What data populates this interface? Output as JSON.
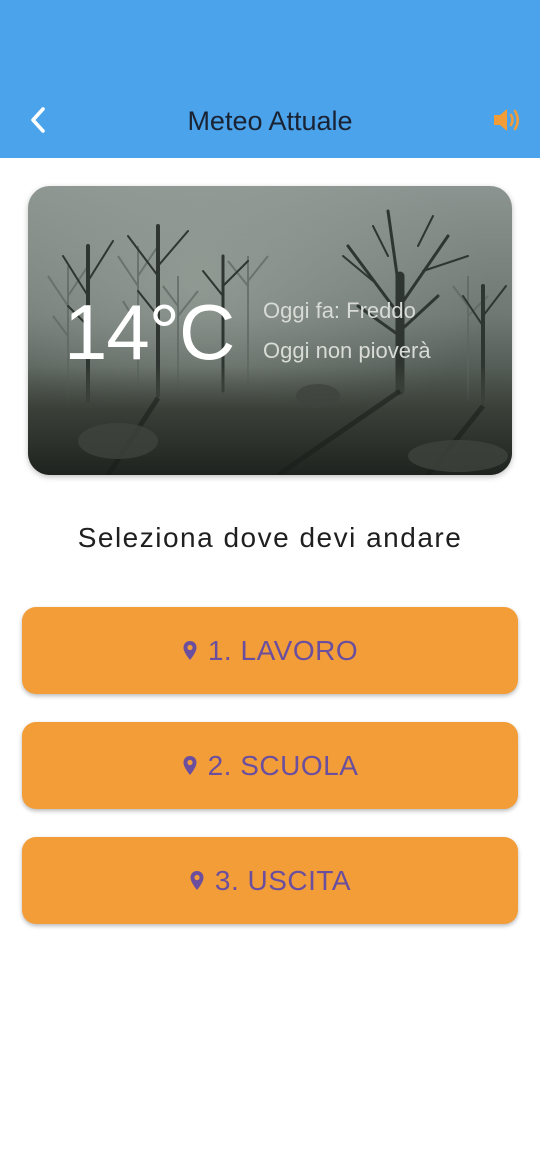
{
  "app_bar": {
    "title": "Meteo Attuale",
    "back_icon": "chevron-left-icon",
    "sound_icon": "speaker-volume-icon",
    "background_color": "#4aa3eb",
    "icon_color_back": "#ffffff",
    "icon_color_sound": "#f29d37"
  },
  "weather": {
    "temperature": "14°C",
    "line1": "Oggi fa: Freddo",
    "line2": "Oggi non pioverà",
    "background": "foggy-forest-image"
  },
  "prompt": "Seleziona dove devi andare",
  "destinations": [
    {
      "label": "1. LAVORO",
      "icon": "location-pin-icon"
    },
    {
      "label": "2. SCUOLA",
      "icon": "location-pin-icon"
    },
    {
      "label": "3. USCITA",
      "icon": "location-pin-icon"
    }
  ],
  "colors": {
    "button_bg": "#f29d37",
    "button_text": "#6b4f9e"
  }
}
